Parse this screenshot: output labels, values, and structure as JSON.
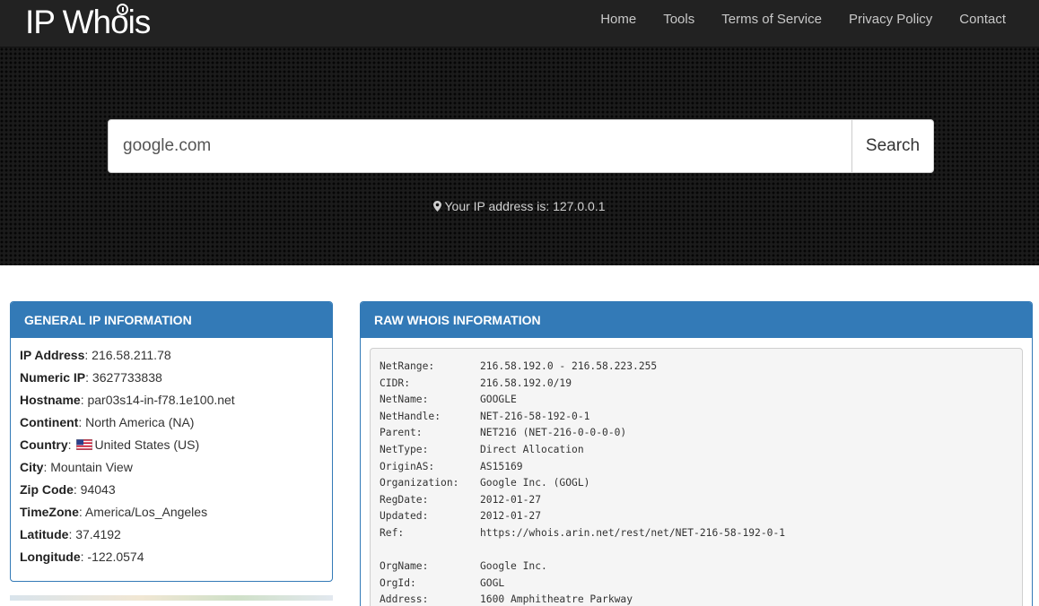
{
  "brand": {
    "logo_text_1": "IP Wh",
    "logo_text_o": "o",
    "logo_text_2": "is"
  },
  "nav": {
    "items": [
      {
        "label": "Home"
      },
      {
        "label": "Tools"
      },
      {
        "label": "Terms of Service"
      },
      {
        "label": "Privacy Policy"
      },
      {
        "label": "Contact"
      }
    ]
  },
  "search": {
    "value": "google.com",
    "button_label": "Search"
  },
  "your_ip": {
    "text": "Your IP address is: 127.0.0.1"
  },
  "general": {
    "title": "GENERAL IP INFORMATION",
    "rows": [
      {
        "label": "IP Address",
        "value": ": 216.58.211.78"
      },
      {
        "label": "Numeric IP",
        "value": ": 3627733838"
      },
      {
        "label": "Hostname",
        "value": ": par03s14-in-f78.1e100.net"
      },
      {
        "label": "Continent",
        "value": ": North America (NA)"
      },
      {
        "label": "Country",
        "value": "United States (US)"
      },
      {
        "label": "City",
        "value": ": Mountain View"
      },
      {
        "label": "Zip Code",
        "value": ": 94043"
      },
      {
        "label": "TimeZone",
        "value": ": America/Los_Angeles"
      },
      {
        "label": "Latitude",
        "value": ": 37.4192"
      },
      {
        "label": "Longitude",
        "value": ": -122.0574"
      }
    ],
    "country_colon": ": ",
    "flag_icon": "us-flag-icon"
  },
  "raw": {
    "title": "RAW WHOIS INFORMATION",
    "lines": [
      {
        "k": "NetRange:",
        "v": "216.58.192.0 - 216.58.223.255"
      },
      {
        "k": "CIDR:",
        "v": "216.58.192.0/19"
      },
      {
        "k": "NetName:",
        "v": "GOOGLE"
      },
      {
        "k": "NetHandle:",
        "v": "NET-216-58-192-0-1"
      },
      {
        "k": "Parent:",
        "v": "NET216 (NET-216-0-0-0-0)"
      },
      {
        "k": "NetType:",
        "v": "Direct Allocation"
      },
      {
        "k": "OriginAS:",
        "v": "AS15169"
      },
      {
        "k": "Organization:",
        "v": "Google Inc. (GOGL)"
      },
      {
        "k": "RegDate:",
        "v": "2012-01-27"
      },
      {
        "k": "Updated:",
        "v": "2012-01-27"
      },
      {
        "k": "Ref:",
        "v": "https://whois.arin.net/rest/net/NET-216-58-192-0-1"
      },
      {
        "k": "",
        "v": ""
      },
      {
        "k": "OrgName:",
        "v": "Google Inc."
      },
      {
        "k": "OrgId:",
        "v": "GOGL"
      },
      {
        "k": "Address:",
        "v": "1600 Amphitheatre Parkway"
      }
    ]
  },
  "colors": {
    "navbar": "#222222",
    "panel_primary": "#337ab7",
    "hero_bg": "#1b1b1b"
  }
}
